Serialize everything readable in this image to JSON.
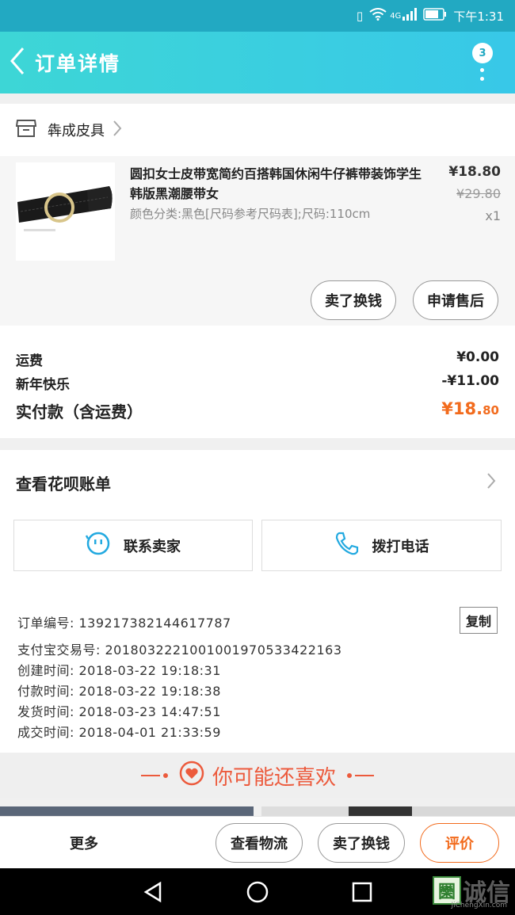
{
  "status_bar": {
    "time": "下午1:31",
    "network": "4G"
  },
  "header": {
    "title": "订单详情",
    "badge": "3"
  },
  "shop": {
    "name": "犇成皮具"
  },
  "item": {
    "title": "圆扣女士皮带宽简约百搭韩国休闲牛仔裤带装饰学生韩版黑潮腰带女",
    "sku": "颜色分类:黑色[尺码参考尺码表];尺码:110cm",
    "price": "¥18.80",
    "original_price": "¥29.80",
    "quantity": "x1",
    "btn_exchange": "卖了换钱",
    "btn_aftersale": "申请售后"
  },
  "fees": {
    "shipping_label": "运费",
    "shipping_value": "¥0.00",
    "discount_label": "新年快乐",
    "discount_value": "-¥11.00",
    "paid_label": "实付款（含运费）",
    "paid_int": "¥18.",
    "paid_dec": "80"
  },
  "huabei": {
    "label": "查看花呗账单"
  },
  "contact": {
    "seller": "联系卖家",
    "call": "拨打电话"
  },
  "order": {
    "number": "订单编号: 1392173821446177​87",
    "alipay": "支付宝交易号: 2018032221001001970533422163",
    "created": "创建时间: 2018-03-22 19:18:31",
    "paid": "付款时间: 2018-03-22 19:18:38",
    "shipped": "发货时间: 2018-03-23 14:47:51",
    "done": "成交时间: 2018-04-01 21:33:59",
    "copy": "复制"
  },
  "recommend": {
    "title": "你可能还喜欢"
  },
  "bottom": {
    "more": "更多",
    "logistics": "查看物流",
    "exchange": "卖了换钱",
    "review": "评价"
  },
  "watermark": {
    "mark": "圞",
    "text": "诚信",
    "sub": "JiChengXin.com"
  },
  "colors": {
    "accent": "#f26b1d",
    "header": "#38c8e8",
    "icon_blue": "#22a9e0"
  }
}
